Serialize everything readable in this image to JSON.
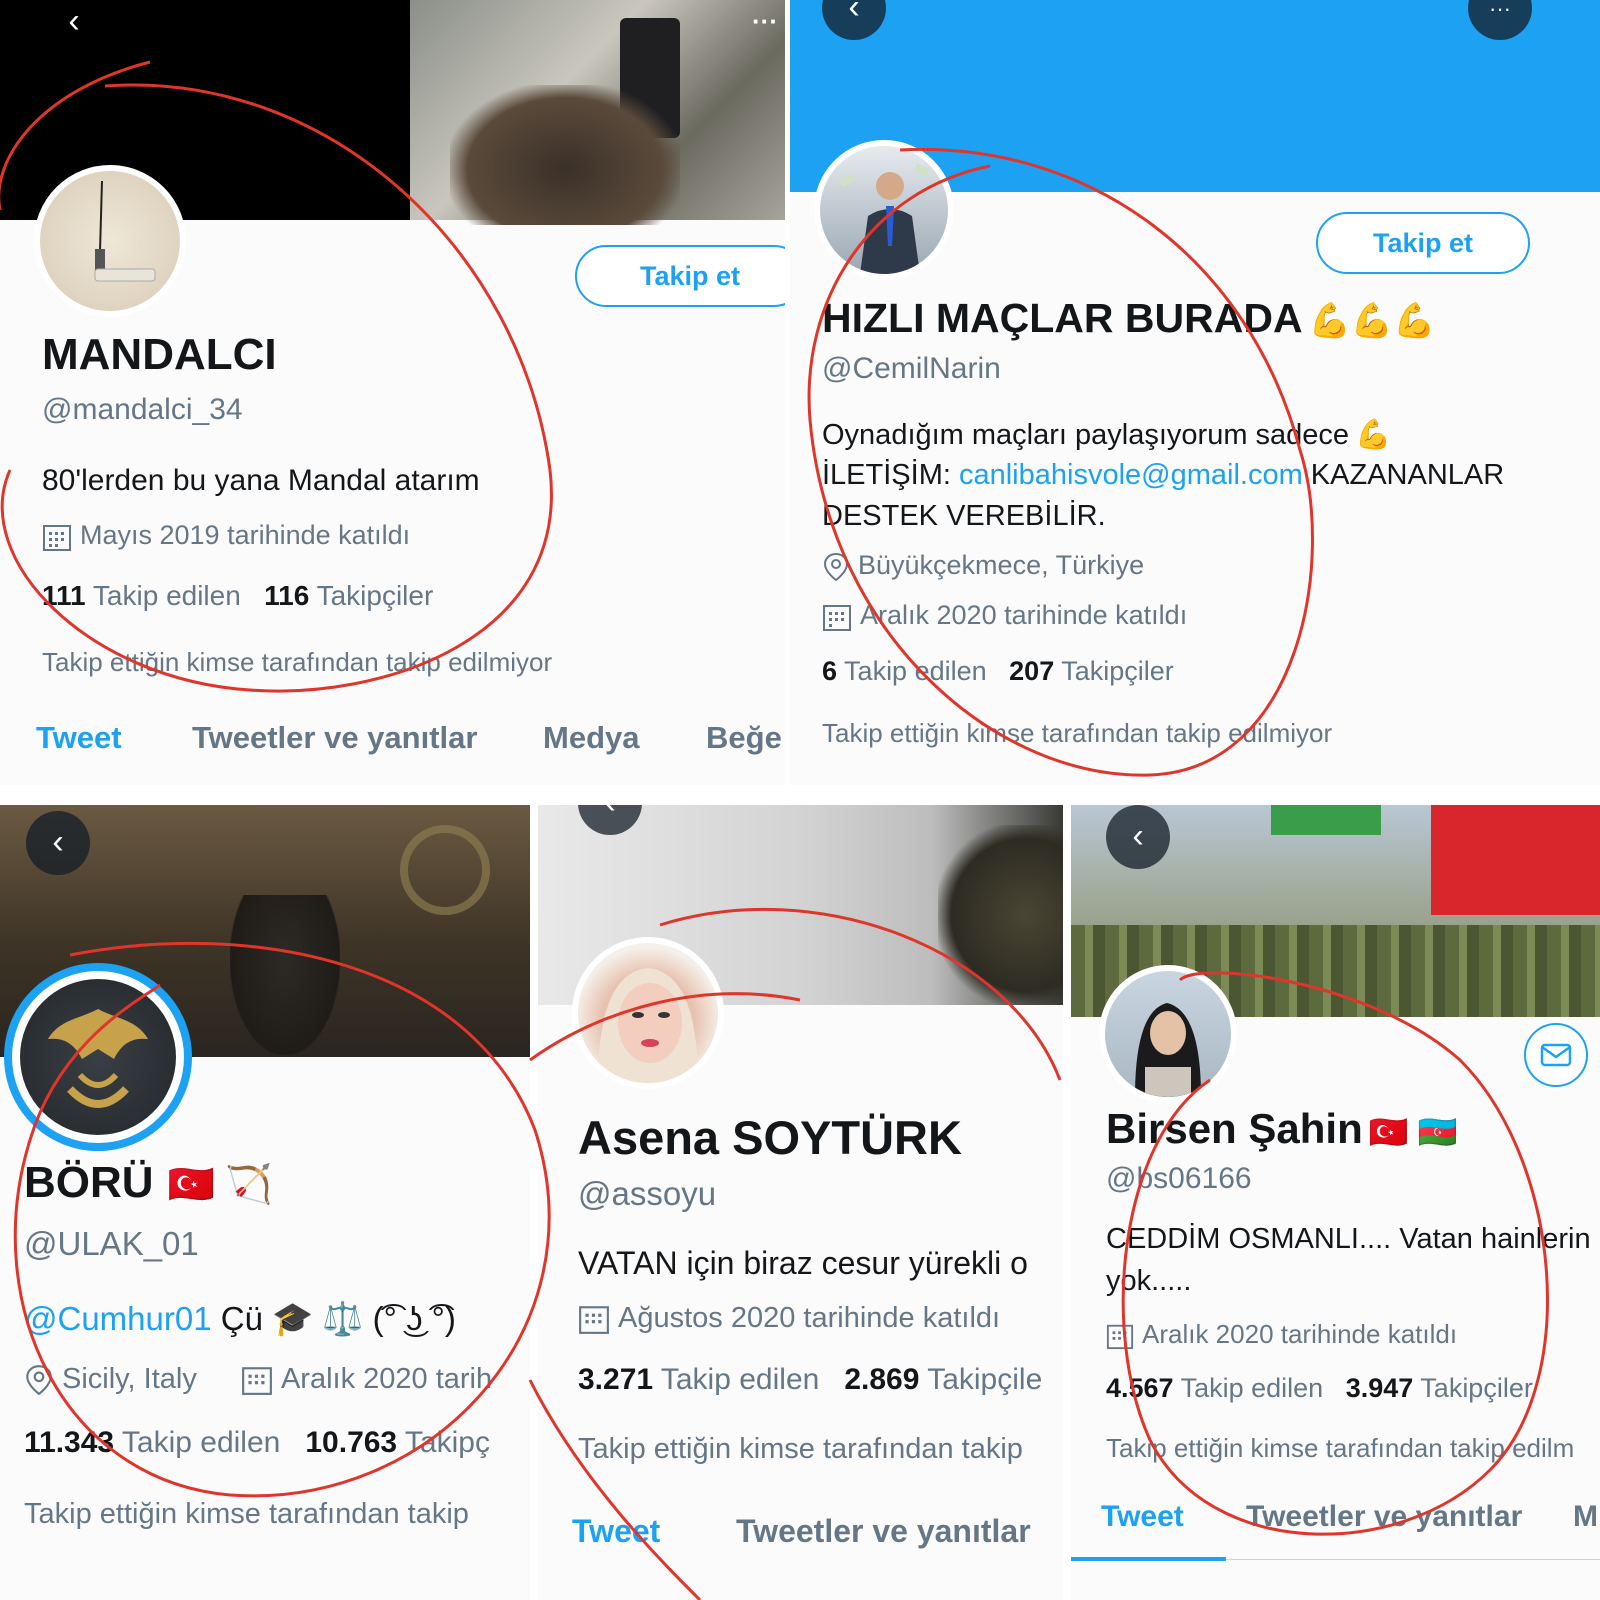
{
  "profiles": [
    {
      "name": "MANDALCI",
      "handle": "@mandalci_34",
      "bio": "80'lerden bu yana Mandal atarım",
      "joined": "Mayıs 2019 tarihinde katıldı",
      "following_count": "111",
      "following_label": "Takip edilen",
      "followers_count": "116",
      "followers_label": "Takipçiler",
      "note": "Takip ettiğin kimse tarafından takip edilmiyor",
      "follow_button": "Takip et",
      "tabs": [
        "Tweet",
        "Tweetler ve yanıtlar",
        "Medya",
        "Beğe"
      ]
    },
    {
      "name": "HIZLI MAÇLAR BURADA",
      "name_emoji": "💪💪💪",
      "handle": "@CemilNarin",
      "bio_line1": "Oynadığım maçları paylaşıyorum sadece",
      "bio_line1_emoji": "💪",
      "bio_line2_prefix": "İLETİŞİM: ",
      "bio_email": "canlibahisvole@gmail.com",
      "bio_line2_suffix": " KAZANANLAR",
      "bio_line3": "DESTEK VEREBİLİR.",
      "location": "Büyükçekmece, Türkiye",
      "joined": "Aralık 2020 tarihinde katıldı",
      "following_count": "6",
      "following_label": "Takip edilen",
      "followers_count": "207",
      "followers_label": "Takipçiler",
      "note": "Takip ettiğin kimse tarafından takip edilmiyor",
      "follow_button": "Takip et",
      "more_icon": "···"
    },
    {
      "name": "BÖRÜ",
      "name_emoji": "🇹🇷 🏹",
      "handle": "@ULAK_01",
      "bio_mention": "@Cumhur01",
      "bio_rest": " Çü 🎓 ⚖️ (͡° ͜ʖ ͡°)",
      "location": "Sicily, Italy",
      "joined": "Aralık 2020 tarih",
      "following_count": "11.343",
      "following_label": "Takip edilen",
      "followers_count": "10.763",
      "followers_label": "Takipç",
      "note": "Takip ettiğin kimse tarafından takip"
    },
    {
      "name": "Asena SOYTÜRK",
      "handle": "@assoyu",
      "bio": "VATAN için biraz cesur yürekli o",
      "joined": "Ağustos 2020 tarihinde katıldı",
      "following_count": "3.271",
      "following_label": "Takip edilen",
      "followers_count": "2.869",
      "followers_label": "Takipçile",
      "note": "Takip ettiğin kimse tarafından takip",
      "tabs": [
        "Tweet",
        "Tweetler ve yanıtlar"
      ]
    },
    {
      "name": "Birsen Şahin",
      "name_emoji": "🇹🇷 🇦🇿",
      "handle": "@bs06166",
      "bio_line1": "CEDDİM OSMANLI.... Vatan hainlerin",
      "bio_line2": "yok.....",
      "joined": "Aralık 2020 tarihinde katıldı",
      "following_count": "4.567",
      "following_label": "Takip edilen",
      "followers_count": "3.947",
      "followers_label": "Takipçiler",
      "note": "Takip ettiğin kimse tarafından takip edilm",
      "tabs": [
        "Tweet",
        "Tweetler ve yanıtlar",
        "M"
      ]
    }
  ],
  "icons": {
    "back": "‹",
    "calendar": "calendar-icon",
    "location": "location-pin-icon",
    "mail": "mail-icon"
  },
  "colors": {
    "accent": "#1da1f2",
    "muted": "#657786",
    "annotation": "#e0352b"
  }
}
